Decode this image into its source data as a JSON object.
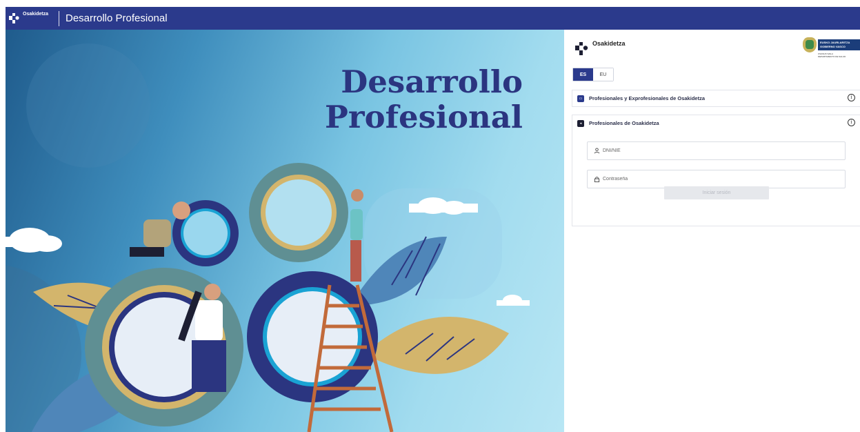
{
  "topbar": {
    "logo_text": "Osakidetza",
    "title": "Desarrollo Profesional"
  },
  "hero": {
    "title_line1": "Desarrollo",
    "title_line2": "Profesional"
  },
  "panel": {
    "logo_text": "Osakidetza",
    "gov_line1": "EUSKO JAURLARITZA",
    "gov_line2": "GOBIERNO VASCO",
    "gov_sub1": "OSASUN SAILA",
    "gov_sub2": "DEPARTAMENTO DE SALUD",
    "languages": [
      {
        "label": "ES",
        "active": true
      },
      {
        "label": "EU",
        "active": false
      }
    ],
    "accordion1": {
      "label": "Profesionales y Exprofesionales de Osakidetza"
    },
    "accordion2": {
      "label": "Profesionales de Osakidetza"
    },
    "dni_placeholder": "DNI/NIE",
    "password_placeholder": "Contraseña",
    "login_label": "Iniciar sesión"
  },
  "colors": {
    "brand": "#2b3a8c",
    "hero_title": "#2b3580",
    "disabled_button": "#e6e8ec"
  }
}
